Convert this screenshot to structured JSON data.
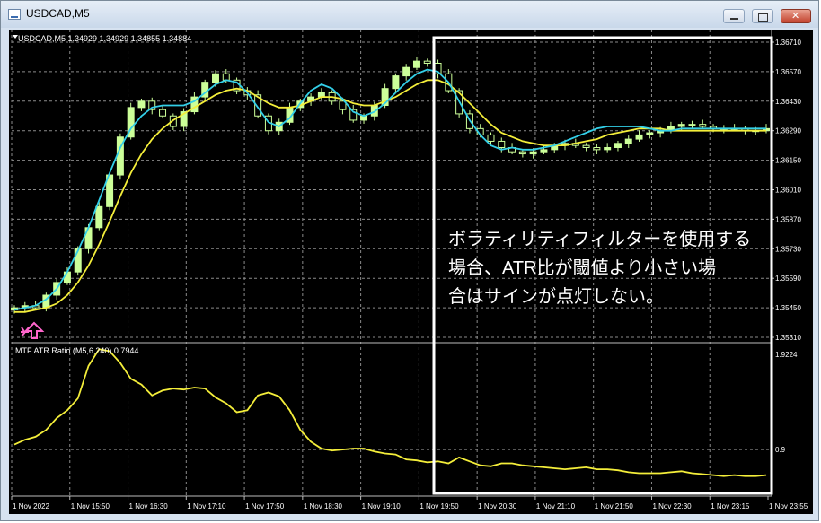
{
  "window": {
    "title": "USDCAD,M5"
  },
  "main_chart": {
    "header": "USDCAD,M5  1.34929 1.34929 1.34855 1.34884",
    "price_ticks": [
      "1.36710",
      "1.36570",
      "1.36430",
      "1.36290",
      "1.36150",
      "1.36010",
      "1.35870",
      "1.35730",
      "1.35590",
      "1.35450",
      "1.35310"
    ]
  },
  "indicator": {
    "header": "MTF ATR Ratio  (M5,6,240) 0.7944",
    "ticks": [
      "1.9224",
      "0.9"
    ]
  },
  "time_ticks": [
    "1 Nov 2022",
    "1 Nov 15:50",
    "1 Nov 16:30",
    "1 Nov 17:10",
    "1 Nov 17:50",
    "1 Nov 18:30",
    "1 Nov 19:10",
    "1 Nov 19:50",
    "1 Nov 20:30",
    "1 Nov 21:10",
    "1 Nov 21:50",
    "1 Nov 22:30",
    "1 Nov 23:15",
    "1 Nov 23:55"
  ],
  "annotation": {
    "lines": [
      "ボラティリティフィルターを使用する",
      "場合、ATR比が閾値より小さい場",
      "合はサインが点灯しない。"
    ]
  },
  "colors": {
    "background": "#000000",
    "bull_candle": "#ccff99",
    "bear_candle": "#000000",
    "fast_ma": "#33cfe8",
    "slow_ma": "#f4ee3a",
    "atr_line": "#f4ee3a",
    "signal_arrow": "#ff66cc",
    "grid": "#8a8a8a"
  },
  "signal": {
    "icon": "up-arrow-icon"
  },
  "chart_data": [
    {
      "type": "candlestick",
      "ylim": [
        1.3531,
        1.3671
      ],
      "series": [
        {
          "name": "candles",
          "close": [
            1.3545,
            1.3546,
            1.3545,
            1.3551,
            1.3557,
            1.3562,
            1.3573,
            1.3583,
            1.3593,
            1.3608,
            1.3626,
            1.364,
            1.3643,
            1.3639,
            1.3636,
            1.3631,
            1.3638,
            1.3645,
            1.3652,
            1.3656,
            1.3653,
            1.3648,
            1.3646,
            1.3636,
            1.3629,
            1.3633,
            1.364,
            1.3643,
            1.3645,
            1.3647,
            1.3643,
            1.3639,
            1.3634,
            1.3636,
            1.3641,
            1.3649,
            1.3655,
            1.3659,
            1.3662,
            1.3661,
            1.3656,
            1.3648,
            1.3637,
            1.363,
            1.3627,
            1.3624,
            1.3621,
            1.3619,
            1.3618,
            1.3619,
            1.362,
            1.3622,
            1.3623,
            1.3622,
            1.3621,
            1.362,
            1.3621,
            1.3623,
            1.3625,
            1.3627,
            1.3628,
            1.3629,
            1.3631,
            1.3632,
            1.3632,
            1.3631,
            1.363,
            1.363,
            1.363,
            1.3629,
            1.3629,
            1.363
          ]
        },
        {
          "name": "fast_ma",
          "values": [
            1.3544,
            1.3545,
            1.3546,
            1.3549,
            1.3554,
            1.3562,
            1.3572,
            1.3583,
            1.3596,
            1.3609,
            1.3621,
            1.363,
            1.3636,
            1.364,
            1.3641,
            1.3641,
            1.3641,
            1.3643,
            1.3647,
            1.3651,
            1.3653,
            1.3652,
            1.3647,
            1.364,
            1.3633,
            1.3631,
            1.3635,
            1.3642,
            1.3648,
            1.3651,
            1.3649,
            1.3644,
            1.3638,
            1.3636,
            1.3638,
            1.3642,
            1.3647,
            1.3652,
            1.3656,
            1.3658,
            1.3657,
            1.3652,
            1.3643,
            1.3634,
            1.3627,
            1.3622,
            1.362,
            1.3621,
            1.362,
            1.362,
            1.3621,
            1.3622,
            1.3624,
            1.3626,
            1.3628,
            1.363,
            1.3631,
            1.3631,
            1.3631,
            1.3631,
            1.363,
            1.3629,
            1.3629,
            1.363,
            1.363,
            1.363,
            1.363,
            1.363,
            1.363,
            1.363,
            1.363,
            1.363
          ]
        },
        {
          "name": "slow_ma",
          "values": [
            1.3543,
            1.3543,
            1.3544,
            1.3545,
            1.3547,
            1.3551,
            1.3557,
            1.3565,
            1.3575,
            1.3586,
            1.3598,
            1.3609,
            1.3618,
            1.3625,
            1.363,
            1.3634,
            1.3637,
            1.364,
            1.3643,
            1.3646,
            1.3648,
            1.3649,
            1.3648,
            1.3645,
            1.3642,
            1.364,
            1.364,
            1.3641,
            1.3643,
            1.3645,
            1.3645,
            1.3644,
            1.3642,
            1.3641,
            1.3641,
            1.3643,
            1.3645,
            1.3648,
            1.3651,
            1.3653,
            1.3653,
            1.3651,
            1.3647,
            1.3642,
            1.3637,
            1.3632,
            1.3628,
            1.3626,
            1.3624,
            1.3623,
            1.3622,
            1.3622,
            1.3622,
            1.3623,
            1.3624,
            1.3625,
            1.3627,
            1.3628,
            1.3629,
            1.363,
            1.363,
            1.363,
            1.3629,
            1.3629,
            1.3629,
            1.3629,
            1.3629,
            1.3629,
            1.3629,
            1.3629,
            1.3629,
            1.3629
          ]
        }
      ]
    },
    {
      "type": "line",
      "ylim": [
        0.5,
        1.9224
      ],
      "series": [
        {
          "name": "MTF ATR Ratio",
          "values": [
            0.95,
            1.0,
            1.03,
            1.1,
            1.22,
            1.3,
            1.42,
            1.75,
            1.92,
            1.9,
            1.78,
            1.62,
            1.56,
            1.45,
            1.5,
            1.52,
            1.51,
            1.53,
            1.52,
            1.43,
            1.37,
            1.28,
            1.3,
            1.45,
            1.48,
            1.44,
            1.3,
            1.1,
            0.98,
            0.91,
            0.89,
            0.9,
            0.91,
            0.91,
            0.88,
            0.86,
            0.85,
            0.8,
            0.79,
            0.77,
            0.78,
            0.76,
            0.82,
            0.78,
            0.74,
            0.73,
            0.76,
            0.76,
            0.74,
            0.73,
            0.72,
            0.71,
            0.7,
            0.71,
            0.72,
            0.7,
            0.7,
            0.69,
            0.67,
            0.66,
            0.66,
            0.66,
            0.67,
            0.68,
            0.66,
            0.65,
            0.64,
            0.63,
            0.64,
            0.63,
            0.63,
            0.64
          ]
        }
      ]
    }
  ]
}
